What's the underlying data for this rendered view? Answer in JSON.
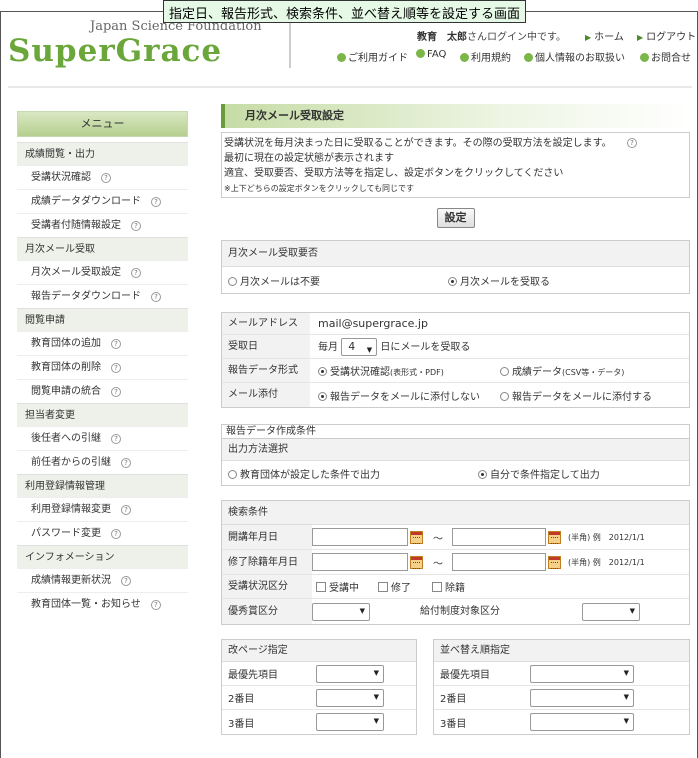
{
  "caption": "指定日、報告形式、検索条件、並べ替え順等を設定する画面",
  "header": {
    "logo_sub": "Japan Science Foundation",
    "logo": "SuperGrace",
    "user_name": "教育　太郎",
    "user_suffix": "さんログイン中です。",
    "home": "ホーム",
    "logout": "ログアウト",
    "links": [
      "ご利用ガイド",
      "FAQ",
      "利用規約",
      "個人情報のお取扱い",
      "お問合せ"
    ]
  },
  "sidebar": {
    "title": "メニュー",
    "groups": [
      {
        "label": "成績閲覧・出力",
        "items": [
          "受講状況確認",
          "成績データダウンロード",
          "受講者付随情報設定"
        ]
      },
      {
        "label": "月次メール受取",
        "items": [
          "月次メール受取設定",
          "報告データダウンロード"
        ]
      },
      {
        "label": "閲覧申請",
        "items": [
          "教育団体の追加",
          "教育団体の削除",
          "閲覧申請の統合"
        ]
      },
      {
        "label": "担当者変更",
        "items": [
          "後任者への引継",
          "前任者からの引継"
        ]
      },
      {
        "label": "利用登録情報管理",
        "items": [
          "利用登録情報変更",
          "パスワード変更"
        ]
      },
      {
        "label": "インフォメーション",
        "items": [
          "成績情報更新状況",
          "教育団体一覧・お知らせ"
        ]
      }
    ]
  },
  "main": {
    "title": "月次メール受取設定",
    "desc": [
      "受講状況を毎月決まった日に受取ることができます。その際の受取方法を設定します。",
      "最初に現在の設定状態が表示されます",
      "適宜、受取要否、受取方法等を指定し、設定ボタンをクリックしてください"
    ],
    "desc_note": "※上下どちらの設定ボタンをクリックしても同じです",
    "set_button": "設定",
    "need": {
      "label": "月次メール受取要否",
      "option_no": "月次メールは不要",
      "option_yes": "月次メールを受取る",
      "selected": "yes"
    },
    "mail": {
      "address_label": "メールアドレス",
      "address": "mail@supergrace.jp",
      "day_label": "受取日",
      "day_prefix": "毎月",
      "day_value": "4",
      "day_suffix": "日にメールを受取る",
      "format_label": "報告データ形式",
      "format_opt1": "受講状況確認",
      "format_opt1_note": "(表形式・PDF)",
      "format_opt2": "成績データ",
      "format_opt2_note": "(CSV等・データ)",
      "attach_label": "メール添付",
      "attach_opt1": "報告データをメールに添付しない",
      "attach_opt2": "報告データをメールに添付する"
    },
    "report": {
      "label": "報告データ作成条件",
      "method_label": "出力方法選択",
      "method_opt1": "教育団体が設定した条件で出力",
      "method_opt2": "自分で条件指定して出力"
    },
    "search": {
      "label": "検索条件",
      "start_label": "開講年月日",
      "end_label": "修了除籍年月日",
      "tilde": "～",
      "hint": "(半角) 例　2012/1/1",
      "status_label": "受講状況区分",
      "status_opts": [
        "受講中",
        "修了",
        "除籍"
      ],
      "award_label": "優秀賞区分",
      "benefit_label": "給付制度対象区分"
    },
    "page_break": {
      "label": "改ページ指定",
      "rows": [
        "最優先項目",
        "2番目",
        "3番目"
      ]
    },
    "sort": {
      "label": "並べ替え順指定",
      "rows": [
        "最優先項目",
        "2番目",
        "3番目"
      ]
    }
  }
}
